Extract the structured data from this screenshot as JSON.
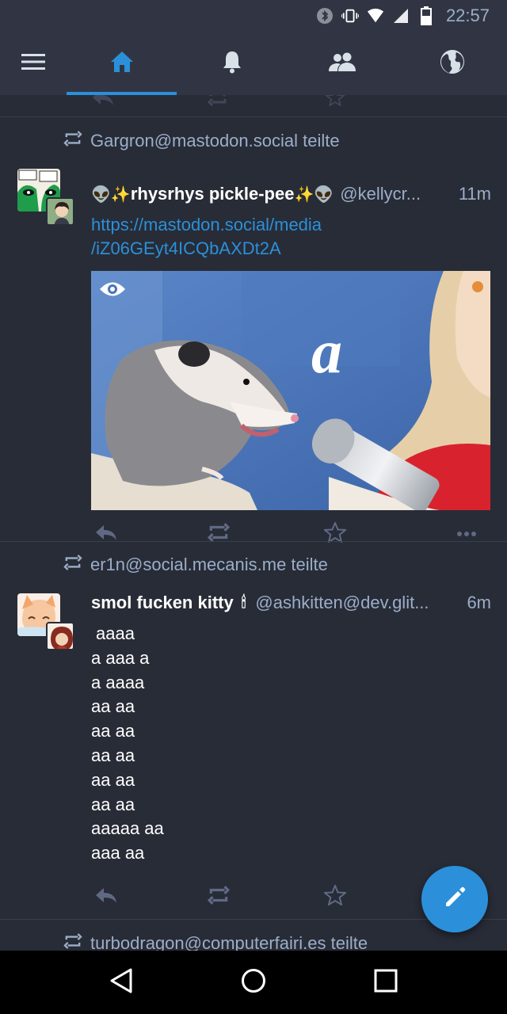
{
  "status_bar": {
    "time": "22:57",
    "icons": [
      "bluetooth-icon",
      "vibrate-icon",
      "wifi-icon",
      "signal-icon",
      "battery-icon"
    ]
  },
  "top_nav": {
    "items": [
      {
        "name": "menu-icon",
        "active": false
      },
      {
        "name": "home-icon",
        "active": true
      },
      {
        "name": "bell-icon",
        "active": false
      },
      {
        "name": "people-icon",
        "active": false
      },
      {
        "name": "globe-icon",
        "active": false
      }
    ],
    "accent": "#2b90d9"
  },
  "feed": {
    "statuses": [
      {
        "boosted_by": "Gargron@mastodon.social teilte",
        "display_name_emoji_left": "👽✨",
        "display_name": "rhysrhys pickle-pee",
        "display_name_emoji_right": "✨👽",
        "account": "@kellycr...",
        "time": "11m",
        "link_line1": "https://mastodon.social/media",
        "link_line2": "/iZ06GEyt4ICQbAXDt2A",
        "media_letter": "a",
        "media_icon": "eye-icon"
      },
      {
        "boosted_by": "er1n@social.mecanis.me teilte",
        "display_name": "smol fucken kitty",
        "display_name_emoji": "🕯",
        "account": "@ashkitten@dev.glit...",
        "time": "6m",
        "lines": [
          "aaaa",
          "a aaa a",
          "a aaaa",
          "aa aa",
          "aa aa",
          "aa aa",
          "aa aa",
          "aa aa",
          "aaaaa aa",
          "aaa aa"
        ]
      },
      {
        "boosted_by": "turbodragon@computerfairi.es teilte"
      }
    ]
  },
  "actions": [
    "reply-icon",
    "boost-icon",
    "star-icon",
    "more-icon"
  ],
  "fab": {
    "name": "compose-icon"
  },
  "system_nav": [
    "back-icon",
    "home-circle-icon",
    "recents-icon"
  ]
}
